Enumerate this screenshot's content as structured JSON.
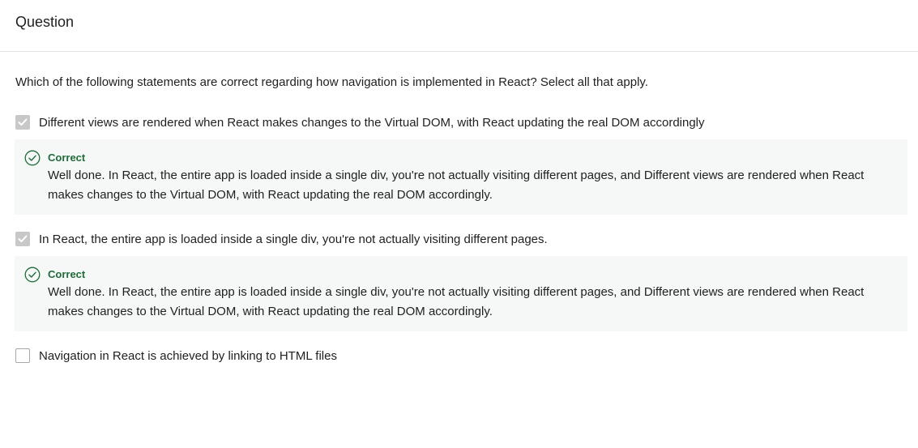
{
  "header": {
    "title": "Question"
  },
  "question": {
    "prompt": "Which of the following statements are correct regarding how navigation is implemented in React? Select all that apply."
  },
  "options": [
    {
      "label": "Different views are rendered when React makes changes to the Virtual DOM, with React updating the real DOM accordingly",
      "checked": true,
      "feedback": {
        "title": "Correct",
        "text": "Well done. In React, the entire app is loaded inside a single div, you're not actually visiting different pages, and Different views are rendered when React makes changes to the Virtual DOM, with React updating the real DOM accordingly."
      }
    },
    {
      "label": "In React, the entire app is loaded inside a single div, you're not actually visiting different pages.",
      "checked": true,
      "feedback": {
        "title": "Correct",
        "text": "Well done. In React, the entire app is loaded inside a single div, you're not actually visiting different pages, and Different views are rendered when React makes changes to the Virtual DOM, with React updating the real DOM accordingly."
      }
    },
    {
      "label": "Navigation in React is achieved by linking to HTML files",
      "checked": false
    }
  ],
  "colors": {
    "correct": "#1f6b3a",
    "feedback_bg": "#f5f8f6",
    "checkbox_checked": "#c8c8c8"
  },
  "icons": {
    "checkbox_checked": "check-icon",
    "feedback": "check-circle-icon"
  }
}
